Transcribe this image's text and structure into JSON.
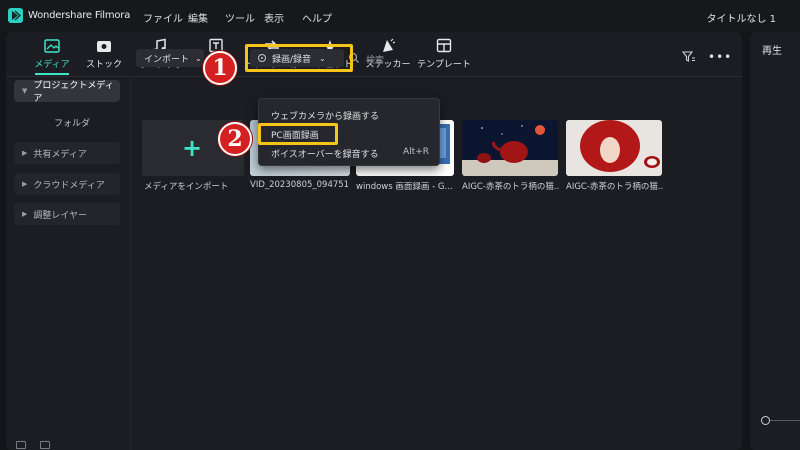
{
  "app": {
    "name": "Wondershare Filmora",
    "doc_title": "タイトルなし 1"
  },
  "menu": [
    "ファイル",
    "編集",
    "ツール",
    "表示",
    "ヘルプ"
  ],
  "toolbar": [
    {
      "label": "メディア",
      "icon": "media-icon",
      "active": true
    },
    {
      "label": "ストック",
      "icon": "stock-icon"
    },
    {
      "label": "オーディオ",
      "icon": "music-note-icon"
    },
    {
      "label": "",
      "icon": "text-icon"
    },
    {
      "label": "トランジション",
      "icon": "transition-icon"
    },
    {
      "label": "エフェクト",
      "icon": "effects-icon"
    },
    {
      "label": "ステッカー",
      "icon": "sticker-icon"
    },
    {
      "label": "テンプレート",
      "icon": "template-icon"
    }
  ],
  "right_panel": {
    "tab": "再生"
  },
  "sidebar": {
    "items": [
      {
        "label": "プロジェクトメディア"
      },
      {
        "label": "フォルダ"
      },
      {
        "label": "共有メディア"
      },
      {
        "label": "クラウドメディア"
      },
      {
        "label": "調整レイヤー"
      }
    ]
  },
  "content_toolbar": {
    "import_label": "インポート",
    "record_label": "録画/録音",
    "search_placeholder": "検索"
  },
  "dropdown": {
    "items": [
      {
        "label": "ウェブカメラから録画する",
        "shortcut": ""
      },
      {
        "label": "PC画面録画",
        "shortcut": ""
      },
      {
        "label": "ボイスオーバーを録音する",
        "shortcut": "Alt+R"
      }
    ]
  },
  "media": {
    "import_tile_label": "メディアをインポート",
    "items": [
      {
        "caption": "VID_20230805_094751"
      },
      {
        "caption": "windows 画面録画 - G..."
      },
      {
        "caption": "AIGC-赤茶のトラ柄の猫..."
      },
      {
        "caption": "AIGC-赤茶のトラ柄の猫..."
      }
    ]
  },
  "annotations": {
    "badge1": "1",
    "badge2": "2",
    "highlight_color": "#f5c518",
    "badge_color": "#d42020"
  },
  "colors": {
    "accent": "#3ee3c8"
  }
}
